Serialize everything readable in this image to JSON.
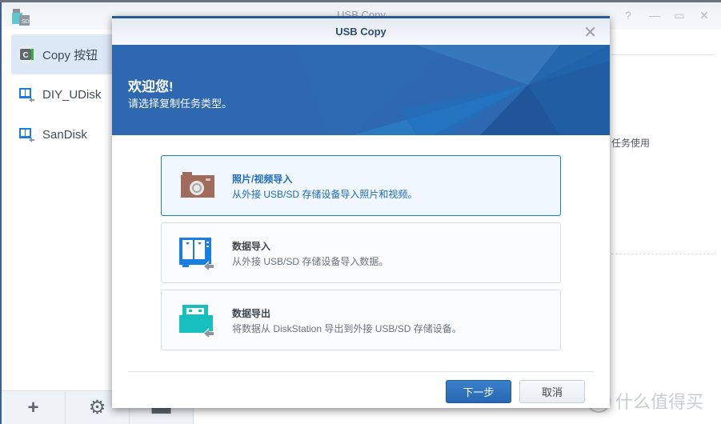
{
  "app": {
    "title": "USB Copy",
    "window_controls": [
      "help-icon",
      "minimize-icon",
      "maximize-icon",
      "close-icon"
    ],
    "sidebar": {
      "items": [
        {
          "label": "Copy 按钮",
          "icon": "copy-button-icon",
          "active": true
        },
        {
          "label": "DIY_UDisk",
          "icon": "usb-import-icon",
          "active": false
        },
        {
          "label": "SanDisk",
          "icon": "usb-import-icon",
          "active": false
        }
      ],
      "footer": [
        {
          "icon": "add-icon",
          "glyph": "+"
        },
        {
          "icon": "gear-icon",
          "glyph": "⚙"
        },
        {
          "icon": "log-icon",
          "glyph": "▬"
        }
      ]
    },
    "background_text": "任务使用"
  },
  "dialog": {
    "title": "USB Copy",
    "close_glyph": "✕",
    "banner": {
      "title": "欢迎您!",
      "subtitle": "请选择复制任务类型。"
    },
    "options": [
      {
        "title": "照片/视频导入",
        "description": "从外接 USB/SD 存储设备导入照片和视频。",
        "icon": "camera-icon",
        "selected": true
      },
      {
        "title": "数据导入",
        "description": "从外接 USB/SD 存储设备导入数据。",
        "icon": "data-import-icon",
        "selected": false
      },
      {
        "title": "数据导出",
        "description": "将数据从 DiskStation 导出到外接 USB/SD 存储设备。",
        "icon": "data-export-icon",
        "selected": false
      }
    ],
    "buttons": {
      "next": "下一步",
      "cancel": "取消"
    }
  },
  "watermark": {
    "badge": "值",
    "text": "什么值得买"
  },
  "colors": {
    "accent": "#2d68b0",
    "selected_border": "#1a7fd0",
    "camera": "#a06b5a",
    "import_blue": "#1a7ee0",
    "export_teal": "#17bfbf"
  }
}
